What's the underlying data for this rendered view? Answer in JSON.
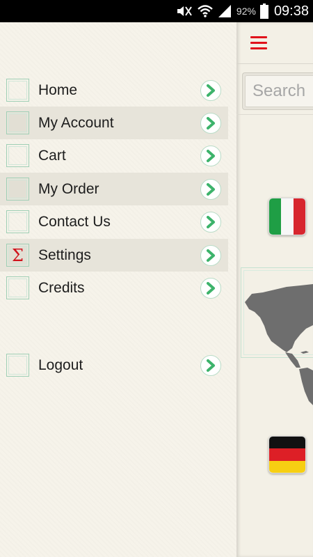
{
  "status_bar": {
    "battery_percent": "92%",
    "time": "09:38",
    "icons": [
      "mute-icon",
      "wifi-icon",
      "signal-icon",
      "battery-icon"
    ]
  },
  "drawer": {
    "items": [
      {
        "label": "Home",
        "icon": "home-icon",
        "highlighted": false
      },
      {
        "label": "My Account",
        "icon": "account-icon",
        "highlighted": true
      },
      {
        "label": "Cart",
        "icon": "cart-icon",
        "highlighted": false
      },
      {
        "label": "My Order",
        "icon": "order-icon",
        "highlighted": true
      },
      {
        "label": "Contact Us",
        "icon": "contact-icon",
        "highlighted": false
      },
      {
        "label": "Settings",
        "icon": "sigma-icon",
        "glyph": "Σ",
        "highlighted": true
      },
      {
        "label": "Credits",
        "icon": "credits-icon",
        "highlighted": false
      },
      {
        "label": "Logout",
        "icon": "logout-icon",
        "highlighted": false
      }
    ]
  },
  "content": {
    "search": {
      "placeholder": "Search",
      "value": ""
    },
    "flags": [
      "italy-flag",
      "germany-flag"
    ]
  },
  "colors": {
    "accent_red": "#e0121b",
    "arrow_green": "#3db36b",
    "drawer_bg": "#f6f3ea",
    "highlight_row": "#e7e4da",
    "map_gray": "#707070"
  }
}
